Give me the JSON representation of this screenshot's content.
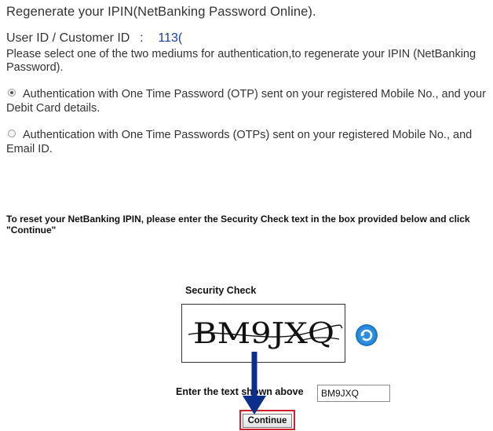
{
  "page": {
    "title": "Regenerate your IPIN(NetBanking Password Online)."
  },
  "user": {
    "label": "User ID / Customer ID",
    "separator": ":",
    "value": "113("
  },
  "instructions": "Please select one of the two mediums for authentication,to regenerate your IPIN (NetBanking Password).",
  "auth_options": [
    {
      "label": "Authentication with One Time Password (OTP) sent on your registered Mobile No., and your Debit Card details.",
      "selected": true
    },
    {
      "label": "Authentication with One Time Passwords (OTPs) sent on your registered Mobile No., and Email ID.",
      "selected": false
    }
  ],
  "reset_note": "To reset your NetBanking IPIN, please enter the Security Check text in the box provided below and click \"Continue\"",
  "security_check": {
    "label": "Security Check",
    "captcha_text": "BM9JXQ",
    "refresh_icon": "refresh-icon",
    "enter_label": "Enter the text shown above",
    "input_value": "BM9JXQ"
  },
  "continue_label": "Continue",
  "colors": {
    "user_id_value": "#1a3e9c",
    "highlight_border": "#d21f2b",
    "arrow": "#0b2f8a",
    "refresh_icon": "#1f78c8"
  },
  "annotations": {
    "arrow_icon": "arrow-down-icon"
  }
}
